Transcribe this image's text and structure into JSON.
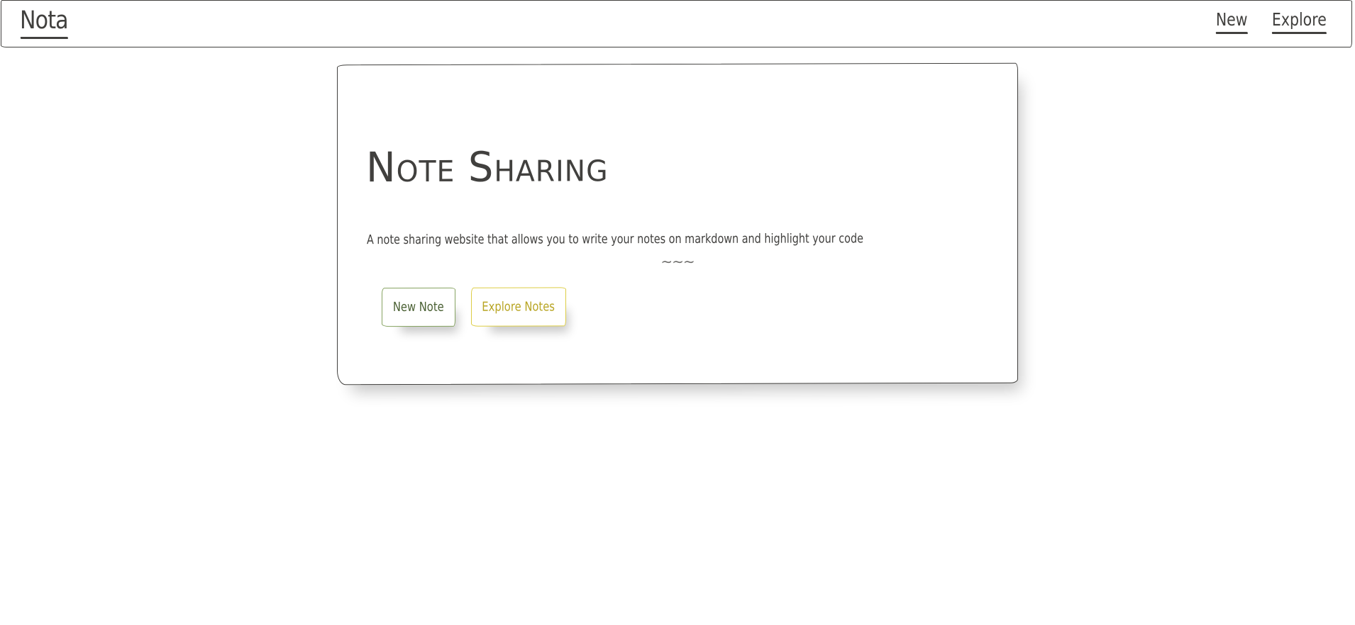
{
  "navbar": {
    "brand": "Nota",
    "links": [
      {
        "label": "New"
      },
      {
        "label": "Explore"
      }
    ]
  },
  "hero": {
    "title": "Note Sharing",
    "description": "A note sharing website that allows you to write your notes on markdown and highlight your code",
    "divider": "~~~",
    "buttons": {
      "new_note": "New Note",
      "explore_notes": "Explore Notes"
    }
  },
  "colors": {
    "text": "#41403e",
    "success": "#86a361",
    "warning": "#ddcd45",
    "background": "#ffffff"
  }
}
